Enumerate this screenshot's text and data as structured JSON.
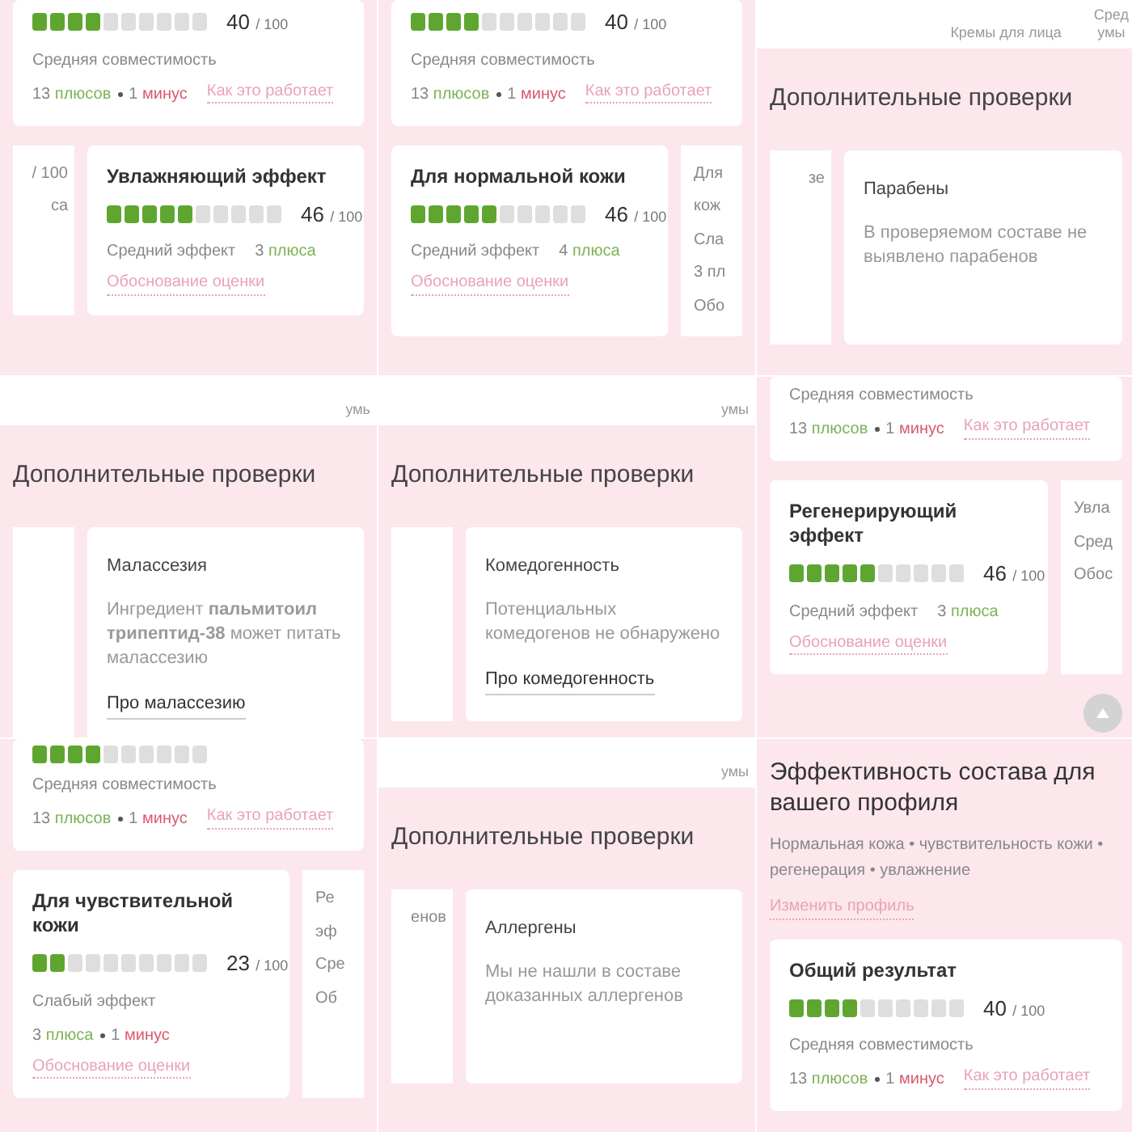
{
  "tiles": [
    {
      "rows": [
        {
          "items": [
            {
              "kind": "compat_score",
              "level": 0.4,
              "score": "40",
              "total": "/ 100",
              "verdict": "Средняя совместимость",
              "pros_count": "13",
              "pros_label": "плюсов",
              "cons_count": "1",
              "cons_label": "минус",
              "link": "Как это работает"
            }
          ]
        },
        {
          "items": [
            {
              "kind": "fragment",
              "texts": [
                "/ 100",
                "са"
              ]
            },
            {
              "kind": "effect_score",
              "title": "Увлажняющий эффект",
              "level": 0.46,
              "score": "46",
              "total": "/ 100",
              "verdict": "Средний эффект",
              "pros_count": "3",
              "pros_label": "плюса",
              "link": "Обоснование оценки"
            }
          ]
        }
      ]
    },
    {
      "rows": [
        {
          "items": [
            {
              "kind": "compat_score",
              "level": 0.4,
              "score": "40",
              "total": "/ 100",
              "verdict": "Средняя совместимость",
              "pros_count": "13",
              "pros_label": "плюсов",
              "cons_count": "1",
              "cons_label": "минус",
              "link": "Как это работает"
            }
          ]
        },
        {
          "items": [
            {
              "kind": "effect_score",
              "title": "Для нормальной кожи",
              "level": 0.46,
              "score": "46",
              "total": "/ 100",
              "verdict": "Средний эффект",
              "pros_count": "4",
              "pros_label": "плюса",
              "link": "Обоснование оценки"
            },
            {
              "kind": "fragment",
              "texts": [
                "Для",
                "кож",
                "Сла",
                "3 пл",
                "Обо"
              ]
            }
          ]
        }
      ]
    },
    {
      "rows": [
        {
          "items": [
            {
              "kind": "strip",
              "texts": [
                "Кремы для лица",
                "Сред\nумы"
              ]
            }
          ]
        },
        {
          "items": [
            {
              "kind": "heading",
              "text": "Дополнительные проверки"
            }
          ]
        },
        {
          "items": [
            {
              "kind": "fragment",
              "texts": [
                "зе"
              ]
            },
            {
              "kind": "check",
              "title": "Парабены",
              "text": "В проверяемом составе не выявлено парабенов"
            }
          ]
        }
      ]
    },
    {
      "rows": [
        {
          "items": [
            {
              "kind": "strip",
              "texts": [
                "умь"
              ]
            }
          ]
        },
        {
          "items": [
            {
              "kind": "heading",
              "text": "Дополнительные проверки"
            }
          ]
        },
        {
          "items": [
            {
              "kind": "fragment"
            },
            {
              "kind": "check",
              "title": "Малассезия",
              "text": "Ингредиент **пальмитоил трипептид-38** может питать малассезию",
              "link": "Про малассезию"
            }
          ]
        }
      ]
    },
    {
      "rows": [
        {
          "items": [
            {
              "kind": "strip",
              "texts": [
                "умы"
              ]
            }
          ]
        },
        {
          "items": [
            {
              "kind": "heading",
              "text": "Дополнительные проверки"
            }
          ]
        },
        {
          "items": [
            {
              "kind": "fragment"
            },
            {
              "kind": "check",
              "title": "Комедогенность",
              "text": "Потенциальных комедогенов не обнаружено",
              "link": "Про комедогенность"
            }
          ]
        }
      ]
    },
    {
      "rows": [
        {
          "items": [
            {
              "kind": "compat_score",
              "verdict": "Средняя совместимость",
              "pros_count": "13",
              "pros_label": "плюсов",
              "cons_count": "1",
              "cons_label": "минус",
              "link": "Как это работает"
            }
          ]
        },
        {
          "items": [
            {
              "kind": "effect_score",
              "title": "Регенерирующий эффект",
              "level": 0.46,
              "score": "46",
              "total": "/ 100",
              "verdict": "Средний эффект",
              "pros_count": "3",
              "pros_label": "плюса",
              "link": "Обоснование оценки"
            },
            {
              "kind": "fragment",
              "texts": [
                "Увла",
                "Сред",
                "Обос"
              ]
            }
          ]
        },
        {
          "items": [
            {
              "kind": "scroll_top"
            }
          ]
        }
      ]
    },
    {
      "rows": [
        {
          "items": [
            {
              "kind": "compat_score",
              "level": 0.4,
              "verdict": "Средняя совместимость",
              "pros_count": "13",
              "pros_label": "плюсов",
              "cons_count": "1",
              "cons_label": "минус",
              "link": "Как это работает"
            }
          ]
        },
        {
          "items": [
            {
              "kind": "effect_score",
              "title": "Для чувствительной кожи",
              "level": 0.23,
              "score": "23",
              "total": "/ 100",
              "verdict": "Слабый эффект",
              "pros_count": "3",
              "pros_label": "плюса",
              "cons_count": "1",
              "cons_label": "минус",
              "link": "Обоснование оценки"
            },
            {
              "kind": "fragment",
              "texts": [
                "Ре",
                "эф",
                "Сре",
                "Об"
              ]
            }
          ]
        }
      ]
    },
    {
      "rows": [
        {
          "items": [
            {
              "kind": "strip",
              "texts": [
                "умы"
              ]
            }
          ]
        },
        {
          "items": [
            {
              "kind": "heading",
              "text": "Дополнительные проверки"
            }
          ]
        },
        {
          "items": [
            {
              "kind": "fragment",
              "texts": [
                "енов"
              ]
            },
            {
              "kind": "check",
              "title": "Аллергены",
              "text": "Мы не нашли в составе доказанных аллергенов"
            }
          ]
        }
      ]
    },
    {
      "rows": [
        {
          "items": [
            {
              "kind": "profile",
              "title": "Эффективность состава для вашего профиля",
              "tags": "Нормальная кожа • чувствительность кожи • регенерация • увлажнение",
              "link": "Изменить профиль"
            }
          ]
        },
        {
          "items": [
            {
              "kind": "compat_score",
              "title": "Общий результат",
              "level": 0.4,
              "score": "40",
              "total": "/ 100",
              "verdict": "Средняя совместимость",
              "pros_count": "13",
              "pros_label": "плюсов",
              "cons_count": "1",
              "cons_label": "минус",
              "link": "Как это работает"
            }
          ]
        }
      ]
    }
  ]
}
